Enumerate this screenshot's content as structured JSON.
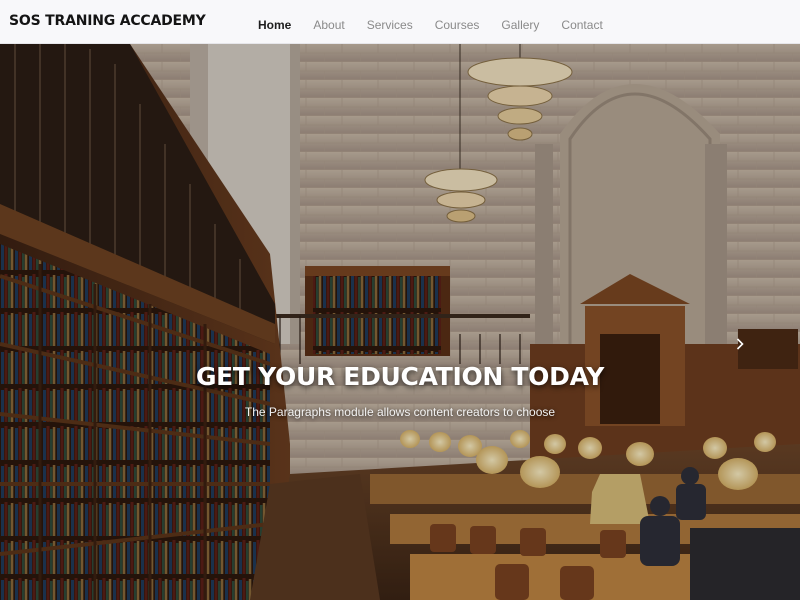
{
  "brand": {
    "name": "SOS TRANING ACCADEMY"
  },
  "nav": {
    "items": [
      {
        "label": "Home",
        "active": true
      },
      {
        "label": "About"
      },
      {
        "label": "Services"
      },
      {
        "label": "Courses"
      },
      {
        "label": "Gallery"
      },
      {
        "label": "Contact"
      }
    ]
  },
  "hero": {
    "title": "GET YOUR EDUCATION TODAY",
    "text": "The Paragraphs module allows content creators to choose",
    "next_icon": "chevron-right-icon"
  },
  "colors": {
    "nav_bg": "#f8f8fa",
    "nav_active": "#1e1e1e",
    "nav_inactive": "#8a8a8a",
    "hero_text": "#ffffff"
  }
}
